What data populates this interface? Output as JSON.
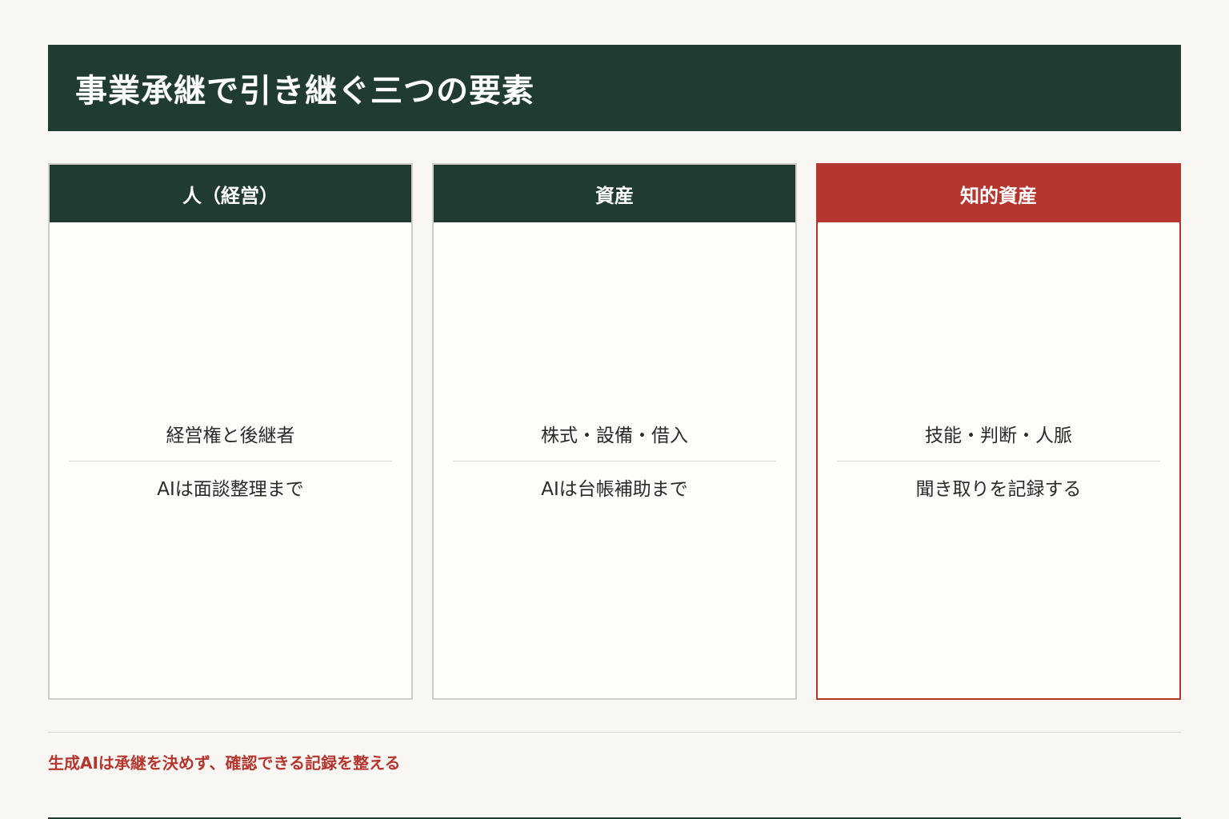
{
  "header": {
    "title": "事業承継で引き継ぐ三つの要素"
  },
  "cards": [
    {
      "title": "人（経営）",
      "line1": "経営権と後継者",
      "line2": "AIは面談整理まで"
    },
    {
      "title": "資産",
      "line1": "株式・設備・借入",
      "line2": "AIは台帳補助まで"
    },
    {
      "title": "知的資産",
      "line1": "技能・判断・人脈",
      "line2": "聞き取りを記録する"
    }
  ],
  "footer": {
    "note": "生成AIは承継を決めず、確認できる記録を整える"
  },
  "colors": {
    "dark_green": "#203b30",
    "accent_red": "#b5362e",
    "background": "#f8f7f3",
    "card_background": "#fefdf9"
  }
}
